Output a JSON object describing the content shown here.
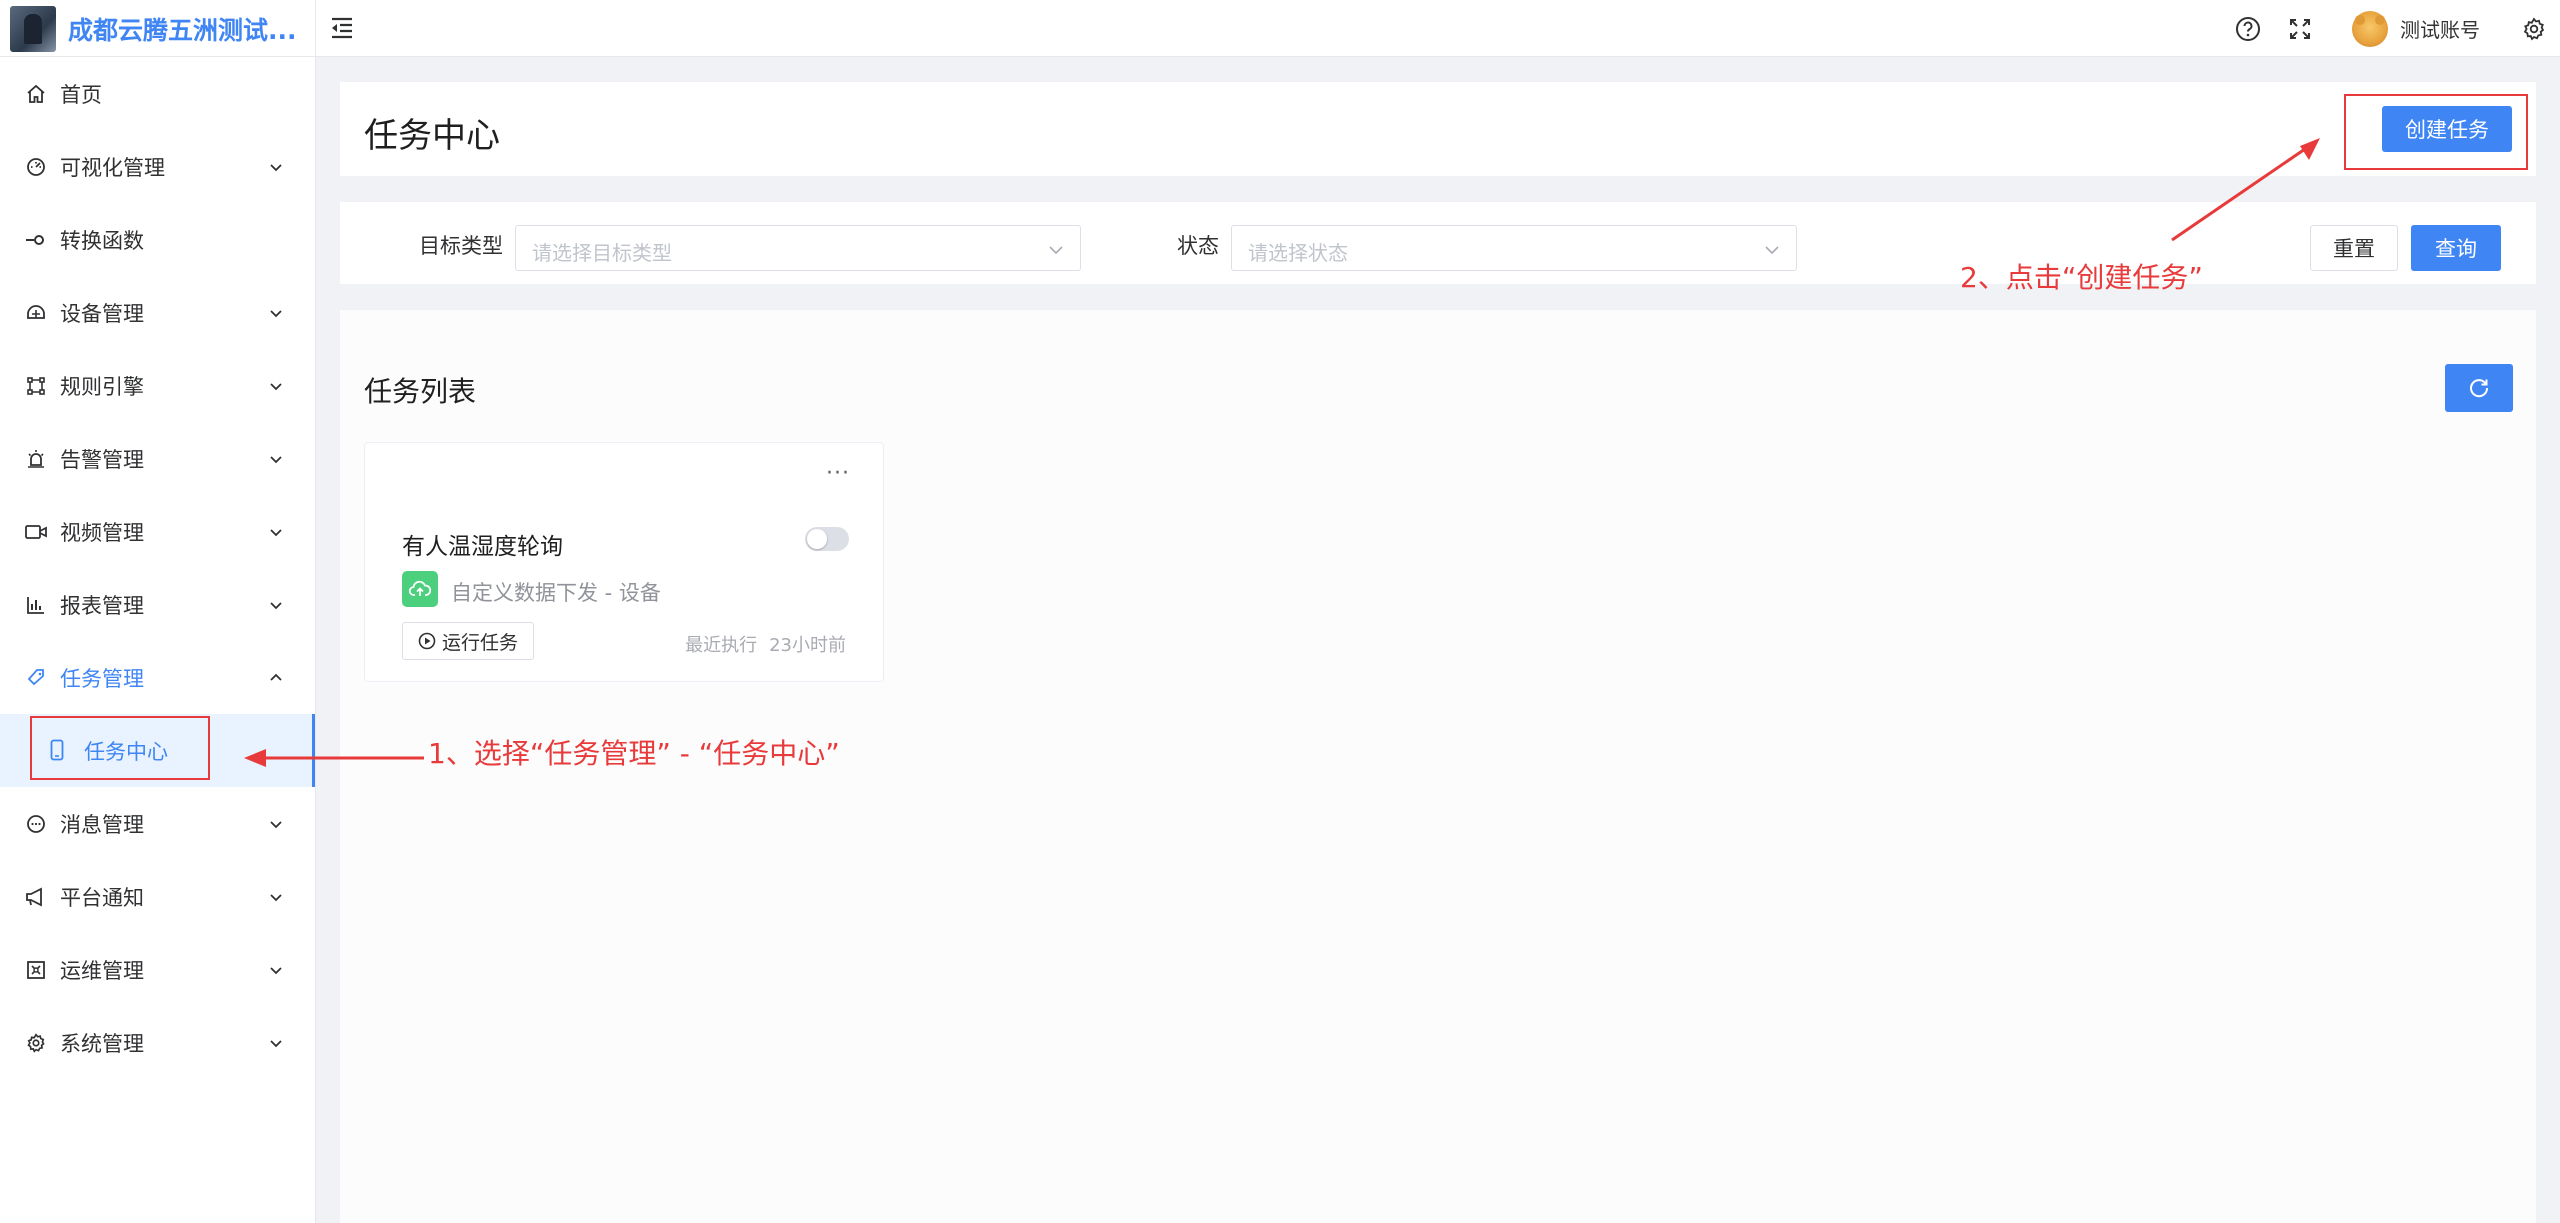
{
  "header": {
    "brand_title": "成都云腾五洲测试...",
    "user_name": "测试账号"
  },
  "sidebar": {
    "items": [
      {
        "label": "首页",
        "icon": "home-icon"
      },
      {
        "label": "可视化管理",
        "icon": "dashboard-icon"
      },
      {
        "label": "转换函数",
        "icon": "function-icon"
      },
      {
        "label": "设备管理",
        "icon": "device-icon"
      },
      {
        "label": "规则引擎",
        "icon": "rule-engine-icon"
      },
      {
        "label": "告警管理",
        "icon": "alarm-icon"
      },
      {
        "label": "视频管理",
        "icon": "video-icon"
      },
      {
        "label": "报表管理",
        "icon": "report-icon"
      },
      {
        "label": "任务管理",
        "icon": "task-icon"
      },
      {
        "label": "消息管理",
        "icon": "message-icon"
      },
      {
        "label": "平台通知",
        "icon": "megaphone-icon"
      },
      {
        "label": "运维管理",
        "icon": "ops-icon"
      },
      {
        "label": "系统管理",
        "icon": "gear-icon"
      }
    ],
    "sub_item": {
      "label": "任务中心",
      "icon": "phone-icon"
    }
  },
  "main": {
    "page_title": "任务中心",
    "create_button": "创建任务",
    "filters": {
      "target_type_label": "目标类型",
      "target_type_placeholder": "请选择目标类型",
      "status_label": "状态",
      "status_placeholder": "请选择状态",
      "reset_button": "重置",
      "query_button": "查询"
    },
    "list_title": "任务列表",
    "tasks": [
      {
        "name": "有人温湿度轮询",
        "type": "自定义数据下发 - 设备",
        "enabled": false,
        "run_button": "运行任务",
        "last_exec_label": "最近执行",
        "last_exec_time": "23小时前",
        "more": "···"
      }
    ]
  },
  "annotations": {
    "step1": "1、选择“任务管理” - “任务中心”",
    "step2": "2、点击“创建任务”",
    "color": "#e83a3a"
  },
  "colors": {
    "primary": "#3f86f4",
    "success": "#4cd07d"
  }
}
